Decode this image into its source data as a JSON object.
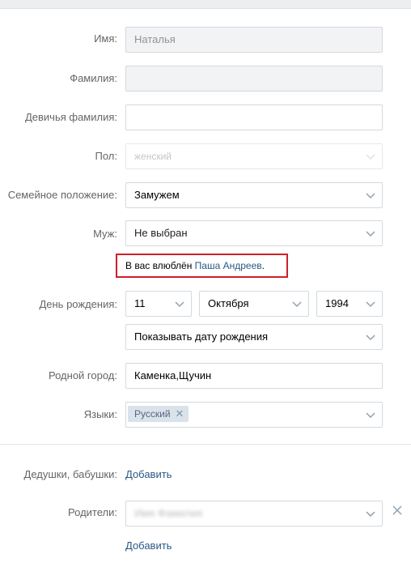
{
  "form": {
    "first_name": {
      "label": "Имя:",
      "value": "Наталья"
    },
    "last_name": {
      "label": "Фамилия:",
      "value": ""
    },
    "maiden_name": {
      "label": "Девичья фамилия:",
      "value": ""
    },
    "gender": {
      "label": "Пол:",
      "value": "женский"
    },
    "relationship": {
      "label": "Семейное положение:",
      "value": "Замужем"
    },
    "spouse": {
      "label": "Муж:",
      "value": "Не выбран"
    },
    "crush_hint": {
      "prefix": "В вас влюблён ",
      "name": "Паша Андреев",
      "suffix": "."
    },
    "birthday": {
      "label": "День рождения:",
      "day": "11",
      "month": "Октября",
      "year": "1994",
      "visibility": "Показывать дату рождения"
    },
    "hometown": {
      "label": "Родной город:",
      "value": "Каменка,Щучин"
    },
    "languages": {
      "label": "Языки:",
      "chip": "Русский"
    }
  },
  "family": {
    "grandparents": {
      "label": "Дедушки, бабушки:",
      "add": "Добавить"
    },
    "parents": {
      "label": "Родители:",
      "value": "Имя Фамилия",
      "add": "Добавить"
    }
  },
  "colors": {
    "link": "#2a5885",
    "highlight_border": "#d0202a"
  }
}
